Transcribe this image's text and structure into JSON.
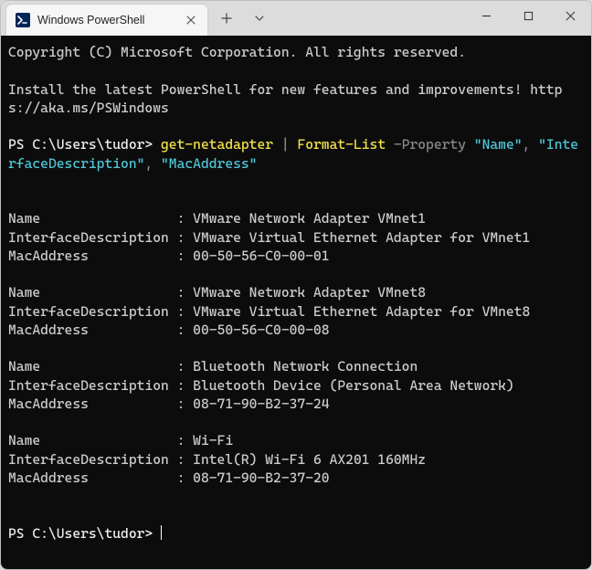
{
  "window": {
    "tab_title": "Windows PowerShell"
  },
  "terminal": {
    "copyright": "Copyright (C) Microsoft Corporation. All rights reserved.",
    "banner": "Install the latest PowerShell for new features and improvements! https://aka.ms/PSWindows",
    "prompt1_prefix": "PS C:\\Users\\tudor> ",
    "cmd_getnet": "get-netadapter",
    "cmd_pipe": " | ",
    "cmd_formatlist": "Format-List",
    "cmd_property_flag": " -Property ",
    "cmd_prop_name": "\"Name\"",
    "cmd_comma1": ", ",
    "cmd_prop_ifdesc": "\"InterfaceDescription\"",
    "cmd_comma2": ", ",
    "cmd_prop_mac": "\"MacAddress\"",
    "labels": {
      "name": "Name                 : ",
      "ifdesc": "InterfaceDescription : ",
      "mac": "MacAddress           : "
    },
    "adapters": [
      {
        "name": "VMware Network Adapter VMnet1",
        "ifdesc": "VMware Virtual Ethernet Adapter for VMnet1",
        "mac": "00-50-56-C0-00-01"
      },
      {
        "name": "VMware Network Adapter VMnet8",
        "ifdesc": "VMware Virtual Ethernet Adapter for VMnet8",
        "mac": "00-50-56-C0-00-08"
      },
      {
        "name": "Bluetooth Network Connection",
        "ifdesc": "Bluetooth Device (Personal Area Network)",
        "mac": "08-71-90-B2-37-24"
      },
      {
        "name": "Wi-Fi",
        "ifdesc": "Intel(R) Wi-Fi 6 AX201 160MHz",
        "mac": "08-71-90-B2-37-20"
      }
    ],
    "prompt2": "PS C:\\Users\\tudor> "
  }
}
